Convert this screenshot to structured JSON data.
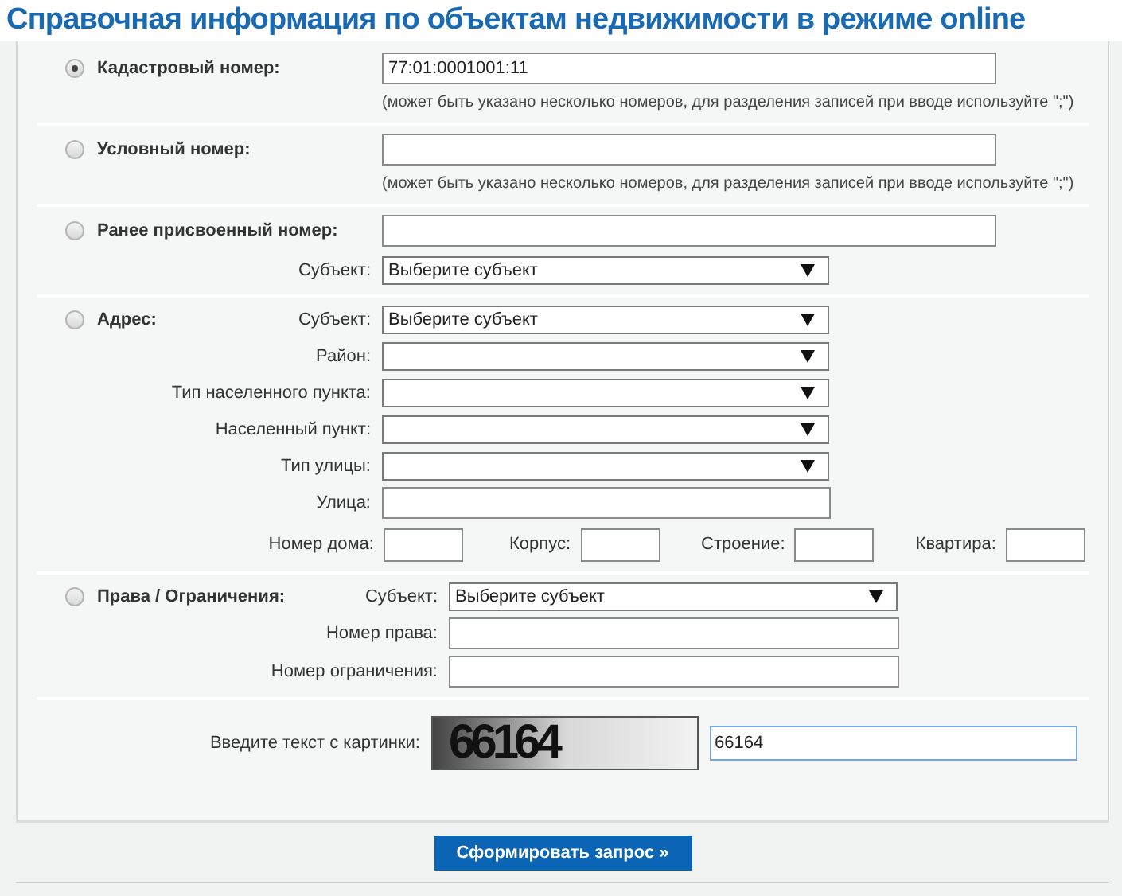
{
  "title": "Справочная информация по объектам недвижимости в режиме online",
  "sections": [
    {
      "kind": "number",
      "selected": true,
      "label": "Кадастровый номер:",
      "value": "77:01:0001001:11",
      "hint": "(может быть указано несколько номеров, для разделения записей при вводе используйте \";\")"
    },
    {
      "kind": "number",
      "selected": false,
      "label": "Условный номер:",
      "hint": "(может быть указано несколько номеров, для разделения записей при вводе используйте \";\")"
    },
    {
      "kind": "number",
      "selected": false,
      "label": "Ранее присвоенный номер:",
      "fields": [
        {
          "kind": "select",
          "label": "Субъект:",
          "value": "Выберите субъект"
        }
      ]
    },
    {
      "kind": "address",
      "selected": false,
      "label": "Адрес:",
      "fields": [
        {
          "kind": "select",
          "label": "Субъект:",
          "value": "Выберите субъект"
        },
        {
          "kind": "select",
          "label": "Район:"
        },
        {
          "kind": "select",
          "label": "Тип населенного пункта:"
        },
        {
          "kind": "select",
          "label": "Населенный пункт:"
        },
        {
          "kind": "select",
          "label": "Тип улицы:"
        },
        {
          "kind": "input",
          "label": "Улица:"
        }
      ],
      "house_fields": [
        {
          "label": "Номер дома:"
        },
        {
          "label": "Корпус:"
        },
        {
          "label": "Строение:"
        },
        {
          "label": "Квартира:"
        }
      ]
    },
    {
      "kind": "rights",
      "selected": false,
      "label": "Права / Ограничения:",
      "fields": [
        {
          "kind": "select",
          "label": "Субъект:",
          "value": "Выберите субъект"
        },
        {
          "kind": "input",
          "label": "Номер права:"
        },
        {
          "kind": "input",
          "label": "Номер ограничения:"
        }
      ]
    }
  ],
  "captcha": {
    "label": "Введите текст с картинки:",
    "image_text": "66164",
    "value": "66164"
  },
  "submit_button": "Сформировать запрос »"
}
